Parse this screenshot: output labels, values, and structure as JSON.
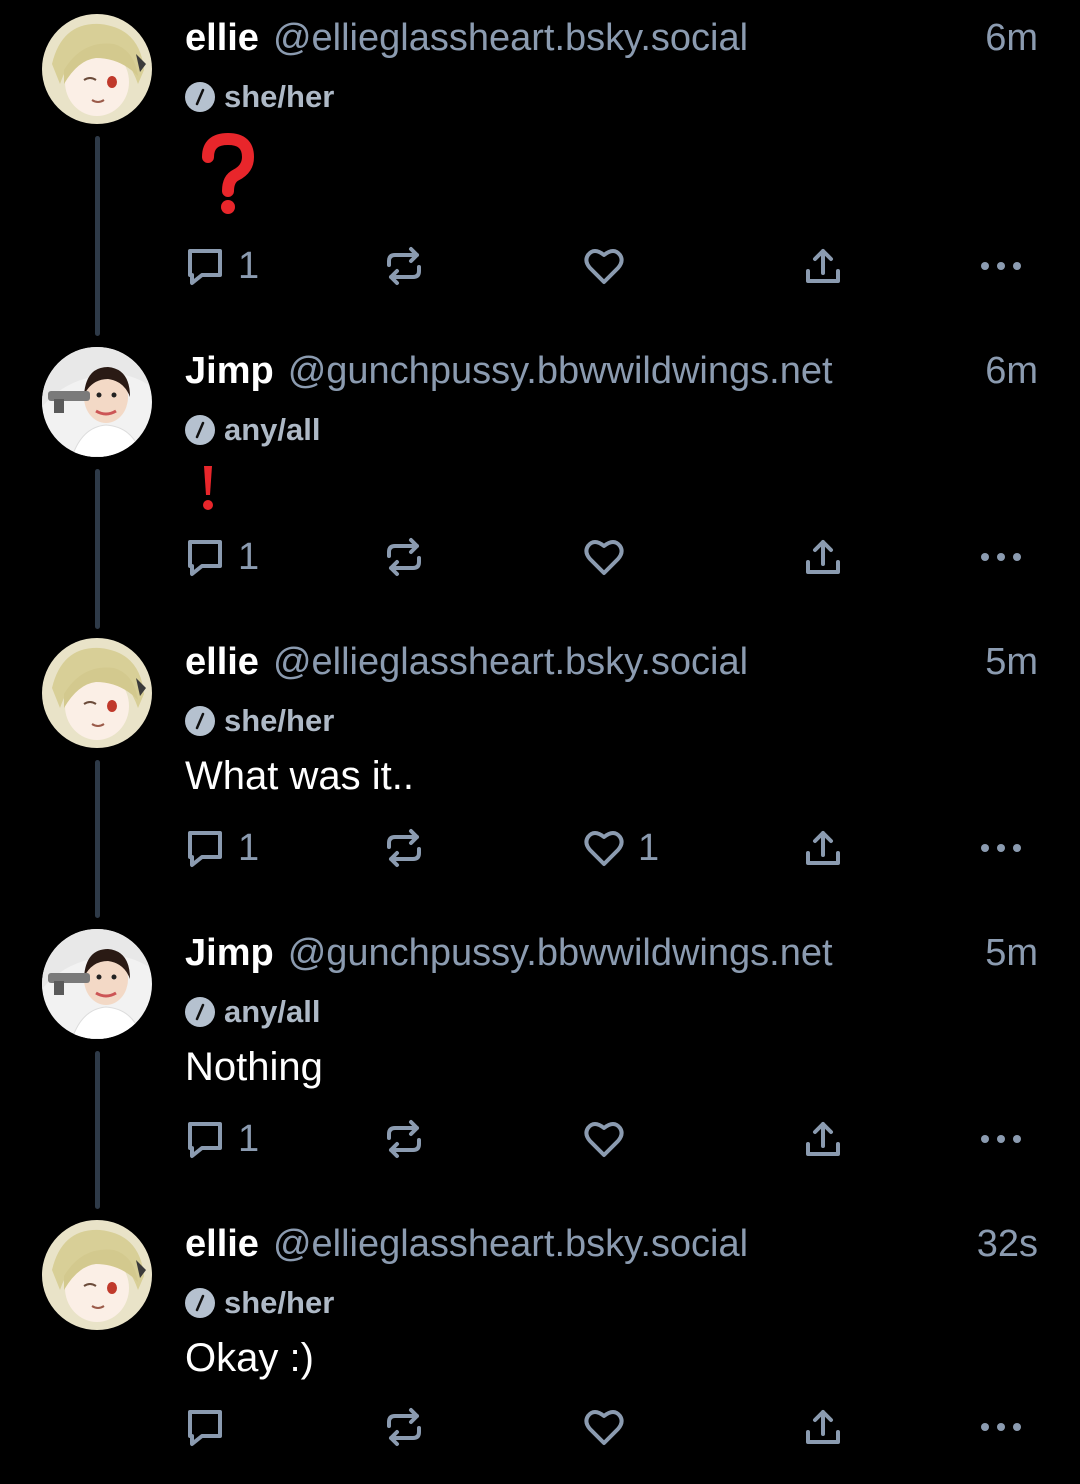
{
  "posts": [
    {
      "author": "ellie",
      "handle": "@ellieglassheart.bsky.social",
      "time": "6m",
      "pronouns": "she/her",
      "text": "",
      "emoji": "question",
      "reply_count": "1",
      "like_count": ""
    },
    {
      "author": "Jimp",
      "handle": "@gunchpussy.bbwwildwings.net",
      "time": "6m",
      "pronouns": "any/all",
      "text": "",
      "emoji": "exclamation",
      "reply_count": "1",
      "like_count": ""
    },
    {
      "author": "ellie",
      "handle": "@ellieglassheart.bsky.social",
      "time": "5m",
      "pronouns": "she/her",
      "text": "What was it..",
      "reply_count": "1",
      "like_count": "1"
    },
    {
      "author": "Jimp",
      "handle": "@gunchpussy.bbwwildwings.net",
      "time": "5m",
      "pronouns": "any/all",
      "text": "Nothing",
      "reply_count": "1",
      "like_count": ""
    },
    {
      "author": "ellie",
      "handle": "@ellieglassheart.bsky.social",
      "time": "32s",
      "pronouns": "she/her",
      "text": "Okay :)",
      "reply_count": "",
      "like_count": ""
    }
  ],
  "icons": {
    "reply": "speech-bubble-icon",
    "repost": "repost-arrows-icon",
    "like": "heart-icon",
    "share": "share-upload-icon",
    "more": "more-dots-icon",
    "pronouns": "pronouns-badge-icon"
  },
  "colors": {
    "background": "#000000",
    "muted_text": "#8b9bb0",
    "thread_line": "#2e3a48",
    "emoji_red": "#e8262b"
  }
}
